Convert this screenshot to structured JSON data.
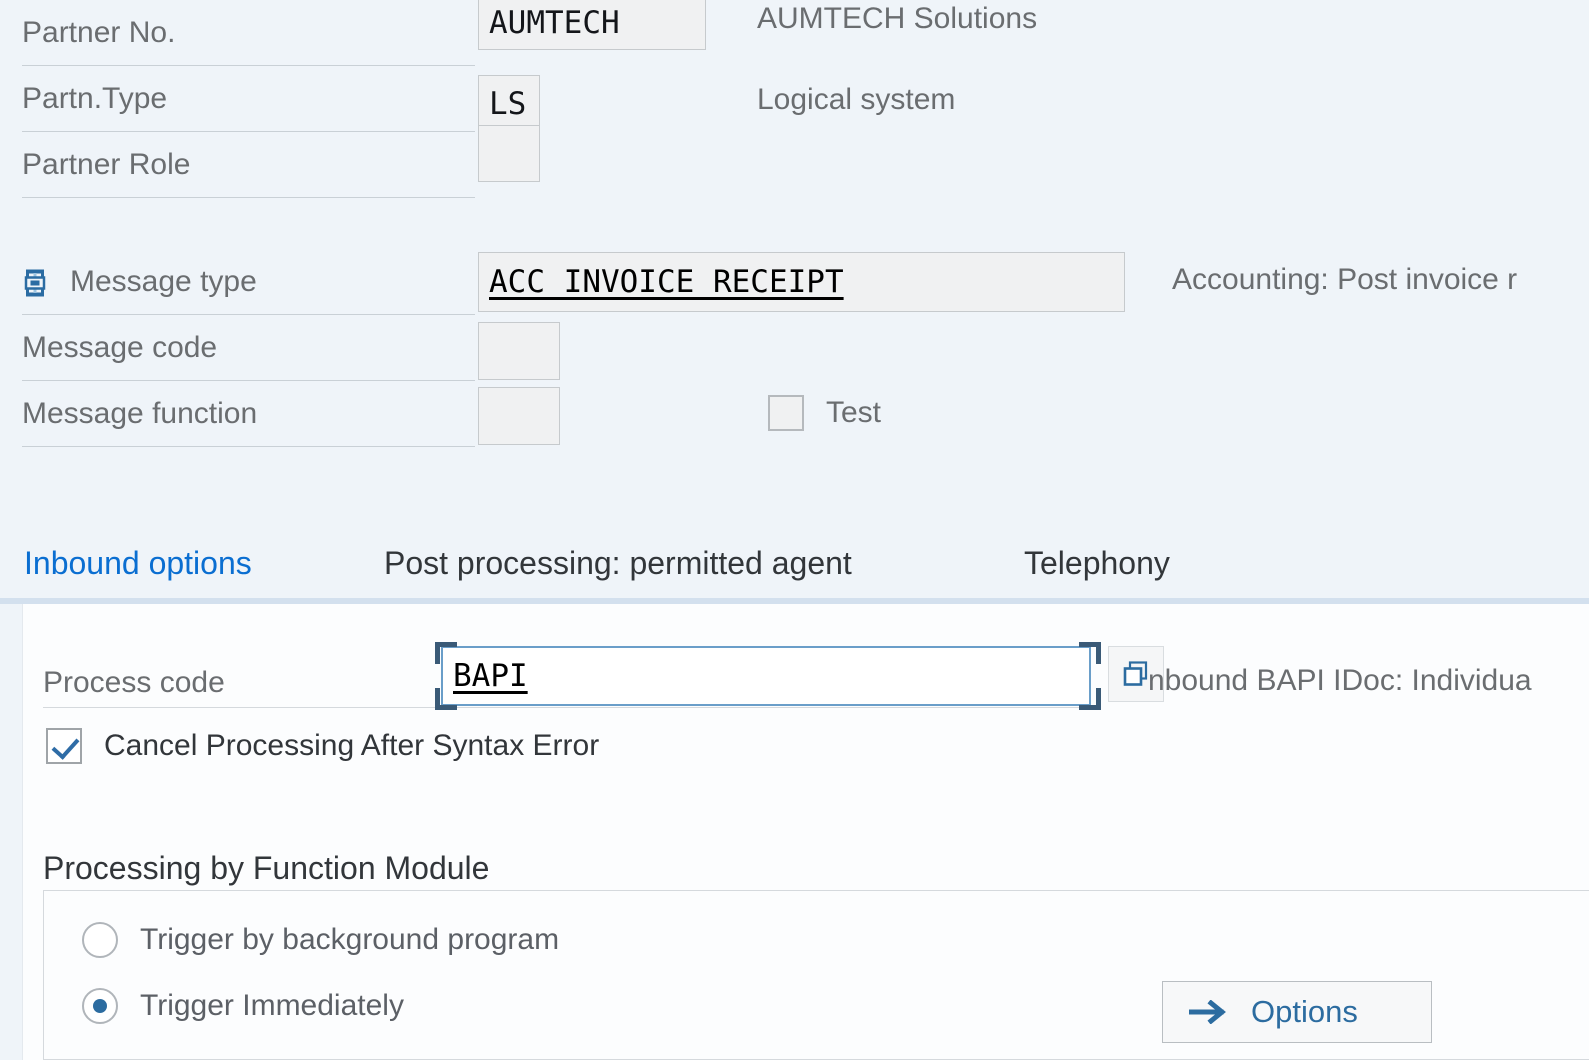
{
  "header": {
    "fields": [
      {
        "label": "Partner No.",
        "value": "AUMTECH",
        "description": "AUMTECH Solutions",
        "icon": ""
      },
      {
        "label": "Partn.Type",
        "value": "LS",
        "description": "Logical system",
        "icon": ""
      },
      {
        "label": "Partner Role",
        "value": "",
        "description": "",
        "icon": ""
      }
    ],
    "message_fields": [
      {
        "label": "Message type",
        "value": "ACC_INVOICE_RECEIPT",
        "description": "Accounting: Post invoice r",
        "icon": "structure-key-icon"
      },
      {
        "label": "Message code",
        "value": "",
        "description": "",
        "icon": ""
      },
      {
        "label": "Message function",
        "value": "",
        "description": "",
        "icon": ""
      }
    ],
    "test_checkbox": {
      "label": "Test",
      "checked": false
    }
  },
  "tabs": [
    {
      "label": "Inbound options",
      "active": true
    },
    {
      "label": "Post processing: permitted agent",
      "active": false
    },
    {
      "label": "Telephony",
      "active": false
    }
  ],
  "inbound_options": {
    "process_code": {
      "label": "Process code",
      "value": "BAPI",
      "description": "nbound BAPI IDoc: Individua",
      "value_help_icon": "value-help-copy-icon",
      "focused": true
    },
    "cancel_processing": {
      "label": "Cancel Processing After Syntax Error",
      "checked": true
    },
    "processing_section": {
      "title": "Processing by Function Module",
      "radios": [
        {
          "label": "Trigger by background program",
          "selected": false
        },
        {
          "label": "Trigger Immediately",
          "selected": true
        }
      ],
      "options_button": {
        "label": "Options",
        "icon": "arrow-right-icon"
      }
    }
  },
  "colors": {
    "header_bg": "#eff4f9",
    "content_bg": "#fcfdfe",
    "accent_blue": "#0a6ed1",
    "link_blue": "#2c6ca0",
    "label_grey": "#6a6d70",
    "field_bg": "#f0f1f2"
  }
}
